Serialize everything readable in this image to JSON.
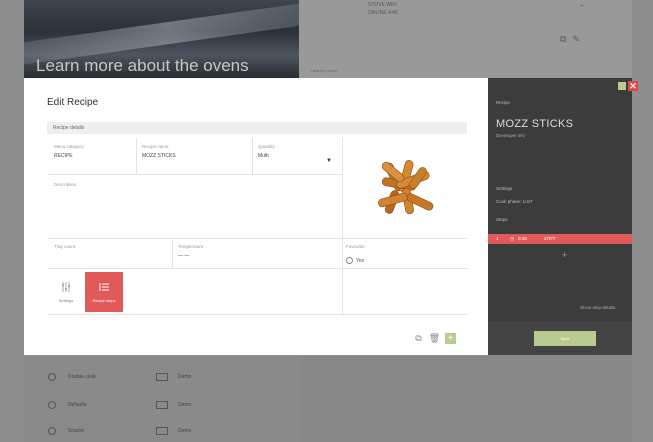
{
  "background": {
    "hero_title": "Learn more about the ovens",
    "top_text_1": "STOVE WIFI",
    "top_text_2": "ONLINE 4:45",
    "strip_text": "Cleaning menu",
    "list": [
      {
        "label": "Double cook",
        "folder": "Demo"
      },
      {
        "label": "Defaults",
        "folder": "Demo"
      },
      {
        "label": "Snacks",
        "folder": "Demo"
      }
    ]
  },
  "modal": {
    "title": "Edit Recipe",
    "section": "Recipe details",
    "fields": {
      "menu_category": {
        "label": "Menu category",
        "value": "RECIPE"
      },
      "recipe_name": {
        "label": "Recipe name",
        "value": "MOZZ STICKS"
      },
      "quantity": {
        "label": "Quantity",
        "value": "Multi"
      },
      "description": {
        "label": "Description",
        "value": ""
      },
      "tray_count": {
        "label": "Tray count",
        "value": ""
      },
      "temperature": {
        "label": "Temperature",
        "value": "— —"
      },
      "favourite": {
        "label": "Favourite",
        "value": "Yes"
      }
    },
    "tiles": {
      "settings": "Settings",
      "recipe_steps": "Recipe steps"
    },
    "photo_alt": "Mozzarella sticks",
    "colors": {
      "accent": "#e05a5a",
      "add": "#b8cc8f",
      "panel": "#3c3c3c"
    }
  },
  "panel": {
    "label": "Recipe",
    "title": "MOZZ STICKS",
    "subtitle": "Developer info",
    "settings_label": "Settings",
    "settings_value": "Cook phase: 1/4/7",
    "steps_label": "Steps",
    "step_bar": {
      "number": "1",
      "time": "0:45",
      "temp": "270°F"
    },
    "footer_link": "Show step details",
    "save_label": "Save"
  }
}
